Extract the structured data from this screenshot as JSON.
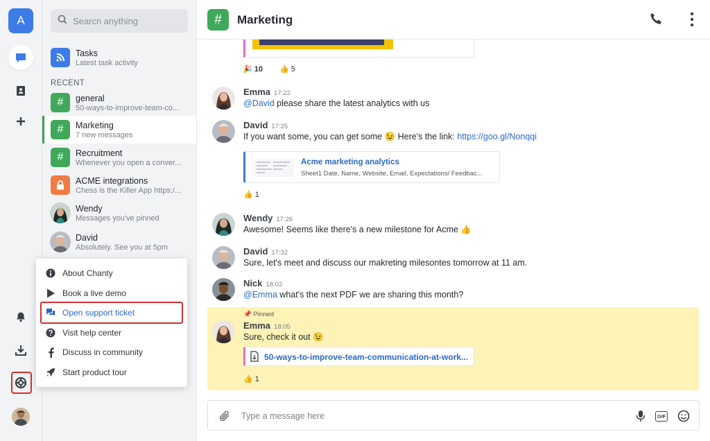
{
  "rail": {
    "workspace_initial": "A",
    "icons": [
      "chat-icon",
      "contacts-icon",
      "plus-icon",
      "bell-icon",
      "download-icon",
      "lifebuoy-icon",
      "user-avatar"
    ]
  },
  "search": {
    "placeholder": "Searcn anything"
  },
  "tasks": {
    "title": "Tasks",
    "subtitle": "Latest task activity"
  },
  "recent_label": "RECENT",
  "conversations": [
    {
      "title": "general",
      "subtitle": "50-ways-to-improve-team-co...",
      "type": "channel",
      "color": "#3fa85a"
    },
    {
      "title": "Marketing",
      "subtitle": "7 new messages",
      "type": "channel",
      "color": "#3fa85a",
      "active": true
    },
    {
      "title": "Recruitment",
      "subtitle": "Whenever you open a conver...",
      "type": "channel",
      "color": "#3fa85a"
    },
    {
      "title": "ACME integrations",
      "subtitle": "Chess is the Killer App https:/...",
      "type": "private-channel",
      "color": "#f07c45"
    },
    {
      "title": "Wendy",
      "subtitle": "Messages you've pinned",
      "type": "person"
    },
    {
      "title": "David",
      "subtitle": "Absolutely. See you at 5pm",
      "type": "person"
    }
  ],
  "help_menu": [
    {
      "label": "About Chanty",
      "icon": "info-icon"
    },
    {
      "label": "Book a live demo",
      "icon": "play-icon"
    },
    {
      "label": "Open support ticket",
      "icon": "chat-bubbles-icon",
      "highlighted": true
    },
    {
      "label": "Visit help center",
      "icon": "question-icon"
    },
    {
      "label": "Discuss in community",
      "icon": "facebook-icon"
    },
    {
      "label": "Start product tour",
      "icon": "rocket-icon"
    }
  ],
  "header": {
    "title": "Marketing",
    "hash": "#"
  },
  "reactions_top": [
    {
      "emoji": "🎉",
      "count": "10"
    },
    {
      "emoji": "👍",
      "count": "5"
    }
  ],
  "messages": [
    {
      "author": "Emma",
      "time": "17:22",
      "mention": "@David",
      "text": " please share the latest analytics with us"
    },
    {
      "author": "David",
      "time": "17:25",
      "text": "If you want some, you can get some 😉 Here's the link: ",
      "link": "https://goo.gl/Nonqqi"
    },
    {
      "author": "Wendy",
      "time": "17:26",
      "text": "Awesome! Seems like there's a new milestone for Acme 👍"
    },
    {
      "author": "David",
      "time": "17:32",
      "text": "Sure, let's meet and discuss our makreting milesontes tomorrow at 11 am."
    },
    {
      "author": "Nick",
      "time": "18:02",
      "mention": "@Emma",
      "text": " what's the next PDF we are sharing this month?"
    },
    {
      "author": "Emma",
      "time": "18:05",
      "text": "Sure, check it out 😉",
      "pinned_label": "Pinned"
    }
  ],
  "link_card": {
    "title": "Acme marketing analytics",
    "description": "Sheet1 Date, Name, Website, Email, Expectations/ Feedbac..."
  },
  "reaction_link": {
    "emoji": "👍",
    "count": "1"
  },
  "file_card": {
    "name": "50-ways-to-improve-team-communication-at-work..."
  },
  "reaction_pinned": {
    "emoji": "👍",
    "count": "1"
  },
  "composer": {
    "placeholder": "Type a message here",
    "gif_label": "GIF"
  },
  "colors": {
    "accent": "#3d7be6",
    "channel_green": "#3fa85a",
    "pinned_bg": "#fdf3b6",
    "highlight_red": "#d32f2f"
  }
}
